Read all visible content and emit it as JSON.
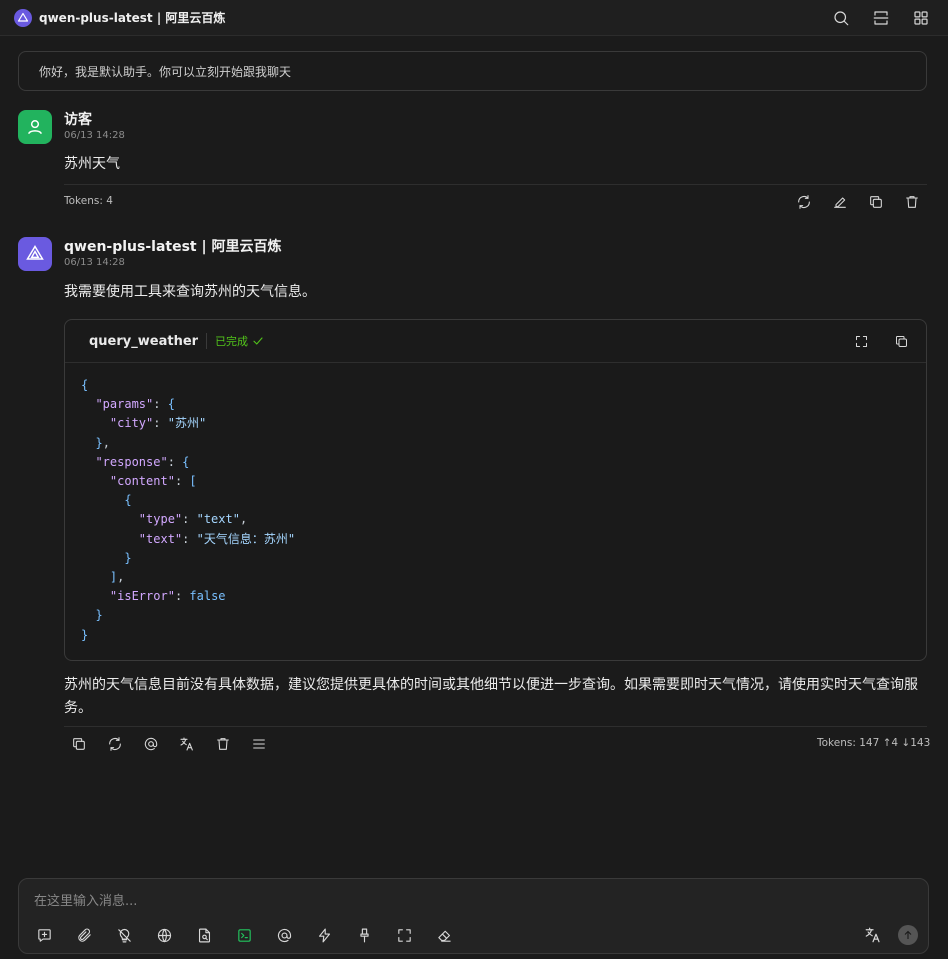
{
  "window": {
    "title": "qwen-plus-latest | 阿里云百炼",
    "actions": [
      "search-icon",
      "split-view-icon",
      "grid-icon"
    ]
  },
  "notice": "你好，我是默认助手。你可以立刻开始跟我聊天",
  "user_message": {
    "name": "访客",
    "time": "06/13 14:28",
    "text": "苏州天气",
    "tokens": "Tokens: 4",
    "actions": [
      "refresh-icon",
      "edit-icon",
      "copy-icon",
      "trash-icon"
    ]
  },
  "assistant_message": {
    "name": "qwen-plus-latest | 阿里云百炼",
    "time": "06/13 14:28",
    "intro": "我需要使用工具来查询苏州的天气信息。",
    "tool": {
      "name": "query_weather",
      "status": "已完成",
      "code_lines": [
        "{",
        "  \"params\": {",
        "    \"city\": \"苏州\"",
        "  },",
        "  \"response\": {",
        "    \"content\": [",
        "      {",
        "        \"type\": \"text\",",
        "        \"text\": \"天气信息：苏州\"",
        "      }",
        "    ],",
        "    \"isError\": false",
        "  }",
        "}"
      ]
    },
    "answer": "苏州的天气信息目前没有具体数据，建议您提供更具体的时间或其他细节以便进一步查询。如果需要即时天气情况，请使用实时天气查询服务。",
    "tokens": "Tokens: 147 ↑4 ↓143",
    "actions": [
      "copy-icon",
      "refresh-icon",
      "at-icon",
      "translate-icon",
      "trash-icon",
      "menu-icon"
    ]
  },
  "composer": {
    "placeholder": "在这里输入消息...",
    "value": "",
    "tools": [
      "new-topic-icon",
      "attachment-icon",
      "thinking-off-icon",
      "globe-icon",
      "knowledge-icon",
      "terminal-icon",
      "at-icon",
      "flash-icon",
      "brush-icon",
      "fullscreen-icon",
      "eraser-icon"
    ],
    "right_tools": [
      "translate-icon",
      "send-icon"
    ]
  },
  "colors": {
    "background": "#1b1b1b",
    "user_avatar": "#22b35e",
    "assistant_avatar": "#6a5ae0",
    "status_green": "#52c41a",
    "terminal_active": "#22c55e"
  }
}
